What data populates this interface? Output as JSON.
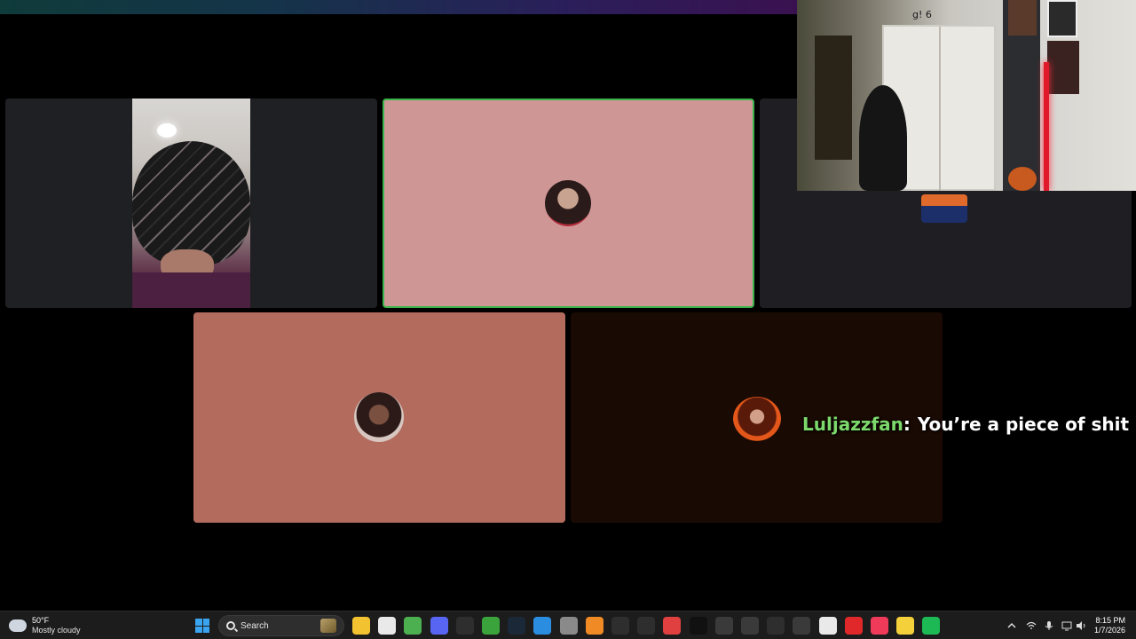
{
  "chat": {
    "username": "Luljazzfan",
    "separator": ":",
    "message": "You’re a piece of shit",
    "username_color": "#7cd86a"
  },
  "webcam": {
    "overlay_text": "g! 6"
  },
  "participants": [
    {
      "tile": 1,
      "type": "video",
      "speaking": false
    },
    {
      "tile": 2,
      "type": "avatar",
      "speaking": true,
      "bg_color": "#cf9696"
    },
    {
      "tile": 3,
      "type": "avatar",
      "speaking": false,
      "bg_color": "#1f1e23"
    },
    {
      "tile": 4,
      "type": "avatar",
      "speaking": false,
      "bg_color": "#b36b5e"
    },
    {
      "tile": 5,
      "type": "avatar",
      "speaking": false,
      "bg_color": "#1a0a04"
    }
  ],
  "speaking_border_color": "#3bb54a",
  "taskbar": {
    "weather": {
      "temp": "50°F",
      "desc": "Mostly cloudy",
      "icon": "cloud-icon"
    },
    "search_label": "Search",
    "apps": [
      {
        "name": "file-explorer-icon",
        "color": "#f2c230"
      },
      {
        "name": "microsoft-store-icon",
        "color": "#e9e9e9"
      },
      {
        "name": "chrome-icon",
        "color": "#4caf50"
      },
      {
        "name": "discord-icon",
        "color": "#5865f2"
      },
      {
        "name": "epic-games-icon",
        "color": "#2e2e2e"
      },
      {
        "name": "xbox-icon",
        "color": "#3ba33b"
      },
      {
        "name": "steam-icon",
        "color": "#1b2838"
      },
      {
        "name": "edge-icon",
        "color": "#2a8de0"
      },
      {
        "name": "minecraft-icon",
        "color": "#8a8a8a"
      },
      {
        "name": "blender-icon",
        "color": "#f08a24"
      },
      {
        "name": "pen-icon",
        "color": "#2e2e2e"
      },
      {
        "name": "settings-icon",
        "color": "#2e2e2e"
      },
      {
        "name": "obs-icon",
        "color": "#e04040"
      },
      {
        "name": "capcut-icon",
        "color": "#111111"
      },
      {
        "name": "app-icon",
        "color": "#3a3a3a"
      },
      {
        "name": "4k-downloader-icon",
        "color": "#3a3a3a"
      },
      {
        "name": "tool-icon",
        "color": "#2e2e2e"
      },
      {
        "name": "ccleaner-icon",
        "color": "#3a3a3a"
      },
      {
        "name": "notepad-icon",
        "color": "#e9e9e9"
      },
      {
        "name": "youtube-icon",
        "color": "#e0282a"
      },
      {
        "name": "itunes-icon",
        "color": "#f03a5a"
      },
      {
        "name": "emoji-app-icon",
        "color": "#f4d03a"
      },
      {
        "name": "spotify-icon",
        "color": "#1db954"
      }
    ],
    "clock": {
      "time": "8:15 PM",
      "date": "1/7/2026"
    }
  }
}
